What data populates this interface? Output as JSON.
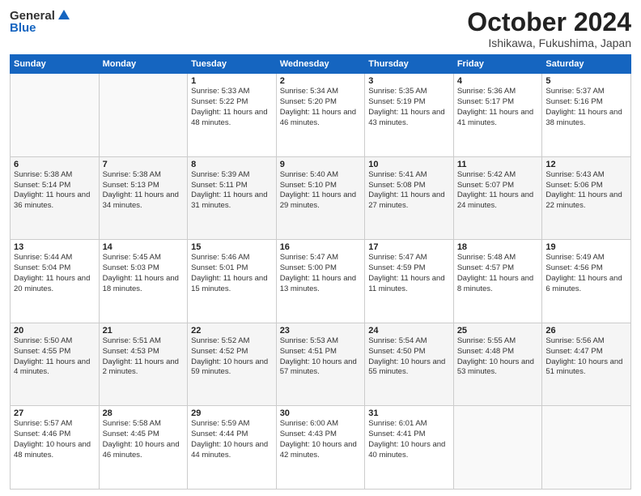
{
  "header": {
    "logo_general": "General",
    "logo_blue": "Blue",
    "month_title": "October 2024",
    "location": "Ishikawa, Fukushima, Japan"
  },
  "weekdays": [
    "Sunday",
    "Monday",
    "Tuesday",
    "Wednesday",
    "Thursday",
    "Friday",
    "Saturday"
  ],
  "weeks": [
    [
      {
        "day": "",
        "empty": true
      },
      {
        "day": "",
        "empty": true
      },
      {
        "day": "1",
        "sunrise": "5:33 AM",
        "sunset": "5:22 PM",
        "daylight": "11 hours and 48 minutes."
      },
      {
        "day": "2",
        "sunrise": "5:34 AM",
        "sunset": "5:20 PM",
        "daylight": "11 hours and 46 minutes."
      },
      {
        "day": "3",
        "sunrise": "5:35 AM",
        "sunset": "5:19 PM",
        "daylight": "11 hours and 43 minutes."
      },
      {
        "day": "4",
        "sunrise": "5:36 AM",
        "sunset": "5:17 PM",
        "daylight": "11 hours and 41 minutes."
      },
      {
        "day": "5",
        "sunrise": "5:37 AM",
        "sunset": "5:16 PM",
        "daylight": "11 hours and 38 minutes."
      }
    ],
    [
      {
        "day": "6",
        "sunrise": "5:38 AM",
        "sunset": "5:14 PM",
        "daylight": "11 hours and 36 minutes."
      },
      {
        "day": "7",
        "sunrise": "5:38 AM",
        "sunset": "5:13 PM",
        "daylight": "11 hours and 34 minutes."
      },
      {
        "day": "8",
        "sunrise": "5:39 AM",
        "sunset": "5:11 PM",
        "daylight": "11 hours and 31 minutes."
      },
      {
        "day": "9",
        "sunrise": "5:40 AM",
        "sunset": "5:10 PM",
        "daylight": "11 hours and 29 minutes."
      },
      {
        "day": "10",
        "sunrise": "5:41 AM",
        "sunset": "5:08 PM",
        "daylight": "11 hours and 27 minutes."
      },
      {
        "day": "11",
        "sunrise": "5:42 AM",
        "sunset": "5:07 PM",
        "daylight": "11 hours and 24 minutes."
      },
      {
        "day": "12",
        "sunrise": "5:43 AM",
        "sunset": "5:06 PM",
        "daylight": "11 hours and 22 minutes."
      }
    ],
    [
      {
        "day": "13",
        "sunrise": "5:44 AM",
        "sunset": "5:04 PM",
        "daylight": "11 hours and 20 minutes."
      },
      {
        "day": "14",
        "sunrise": "5:45 AM",
        "sunset": "5:03 PM",
        "daylight": "11 hours and 18 minutes."
      },
      {
        "day": "15",
        "sunrise": "5:46 AM",
        "sunset": "5:01 PM",
        "daylight": "11 hours and 15 minutes."
      },
      {
        "day": "16",
        "sunrise": "5:47 AM",
        "sunset": "5:00 PM",
        "daylight": "11 hours and 13 minutes."
      },
      {
        "day": "17",
        "sunrise": "5:47 AM",
        "sunset": "4:59 PM",
        "daylight": "11 hours and 11 minutes."
      },
      {
        "day": "18",
        "sunrise": "5:48 AM",
        "sunset": "4:57 PM",
        "daylight": "11 hours and 8 minutes."
      },
      {
        "day": "19",
        "sunrise": "5:49 AM",
        "sunset": "4:56 PM",
        "daylight": "11 hours and 6 minutes."
      }
    ],
    [
      {
        "day": "20",
        "sunrise": "5:50 AM",
        "sunset": "4:55 PM",
        "daylight": "11 hours and 4 minutes."
      },
      {
        "day": "21",
        "sunrise": "5:51 AM",
        "sunset": "4:53 PM",
        "daylight": "11 hours and 2 minutes."
      },
      {
        "day": "22",
        "sunrise": "5:52 AM",
        "sunset": "4:52 PM",
        "daylight": "10 hours and 59 minutes."
      },
      {
        "day": "23",
        "sunrise": "5:53 AM",
        "sunset": "4:51 PM",
        "daylight": "10 hours and 57 minutes."
      },
      {
        "day": "24",
        "sunrise": "5:54 AM",
        "sunset": "4:50 PM",
        "daylight": "10 hours and 55 minutes."
      },
      {
        "day": "25",
        "sunrise": "5:55 AM",
        "sunset": "4:48 PM",
        "daylight": "10 hours and 53 minutes."
      },
      {
        "day": "26",
        "sunrise": "5:56 AM",
        "sunset": "4:47 PM",
        "daylight": "10 hours and 51 minutes."
      }
    ],
    [
      {
        "day": "27",
        "sunrise": "5:57 AM",
        "sunset": "4:46 PM",
        "daylight": "10 hours and 48 minutes."
      },
      {
        "day": "28",
        "sunrise": "5:58 AM",
        "sunset": "4:45 PM",
        "daylight": "10 hours and 46 minutes."
      },
      {
        "day": "29",
        "sunrise": "5:59 AM",
        "sunset": "4:44 PM",
        "daylight": "10 hours and 44 minutes."
      },
      {
        "day": "30",
        "sunrise": "6:00 AM",
        "sunset": "4:43 PM",
        "daylight": "10 hours and 42 minutes."
      },
      {
        "day": "31",
        "sunrise": "6:01 AM",
        "sunset": "4:41 PM",
        "daylight": "10 hours and 40 minutes."
      },
      {
        "day": "",
        "empty": true
      },
      {
        "day": "",
        "empty": true
      }
    ]
  ]
}
